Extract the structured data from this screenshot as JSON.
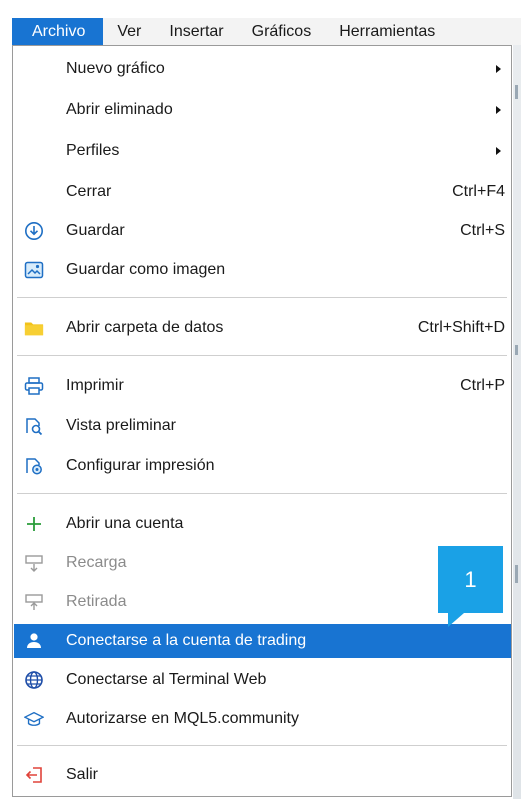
{
  "menubar": {
    "items": [
      "Archivo",
      "Ver",
      "Insertar",
      "Gráficos",
      "Herramientas"
    ]
  },
  "menu": {
    "items": [
      {
        "label": "Nuevo gráfico",
        "icon": null,
        "submenu": true
      },
      {
        "label": "Abrir eliminado",
        "icon": null,
        "submenu": true
      },
      {
        "label": "Perfiles",
        "icon": null,
        "submenu": true
      },
      {
        "label": "Cerrar",
        "icon": null,
        "shortcut": "Ctrl+F4"
      },
      {
        "label": "Guardar",
        "icon": "save-icon",
        "shortcut": "Ctrl+S"
      },
      {
        "label": "Guardar como imagen",
        "icon": "image-icon"
      },
      {
        "label": "Abrir carpeta de datos",
        "icon": "folder-icon",
        "shortcut": "Ctrl+Shift+D"
      },
      {
        "label": "Imprimir",
        "icon": "printer-icon",
        "shortcut": "Ctrl+P"
      },
      {
        "label": "Vista preliminar",
        "icon": "print-preview-icon"
      },
      {
        "label": "Configurar impresión",
        "icon": "print-settings-icon"
      },
      {
        "label": "Abrir una cuenta",
        "icon": "plus-icon"
      },
      {
        "label": "Recarga",
        "icon": "deposit-icon",
        "disabled": true
      },
      {
        "label": "Retirada",
        "icon": "withdraw-icon",
        "disabled": true
      },
      {
        "label": "Conectarse a la cuenta de trading",
        "icon": "user-icon",
        "highlighted": true
      },
      {
        "label": "Conectarse al Terminal Web",
        "icon": "globe-icon"
      },
      {
        "label": "Autorizarse en MQL5.community",
        "icon": "graduation-cap-icon"
      },
      {
        "label": "Salir",
        "icon": "exit-icon"
      }
    ]
  },
  "callout": {
    "number": "1"
  },
  "colors": {
    "accent": "#1874d2",
    "callout": "#1aa1e6",
    "exit_icon": "#e0433a",
    "plus_icon": "#2a9d3a",
    "folder_icon": "#f2c21a"
  }
}
